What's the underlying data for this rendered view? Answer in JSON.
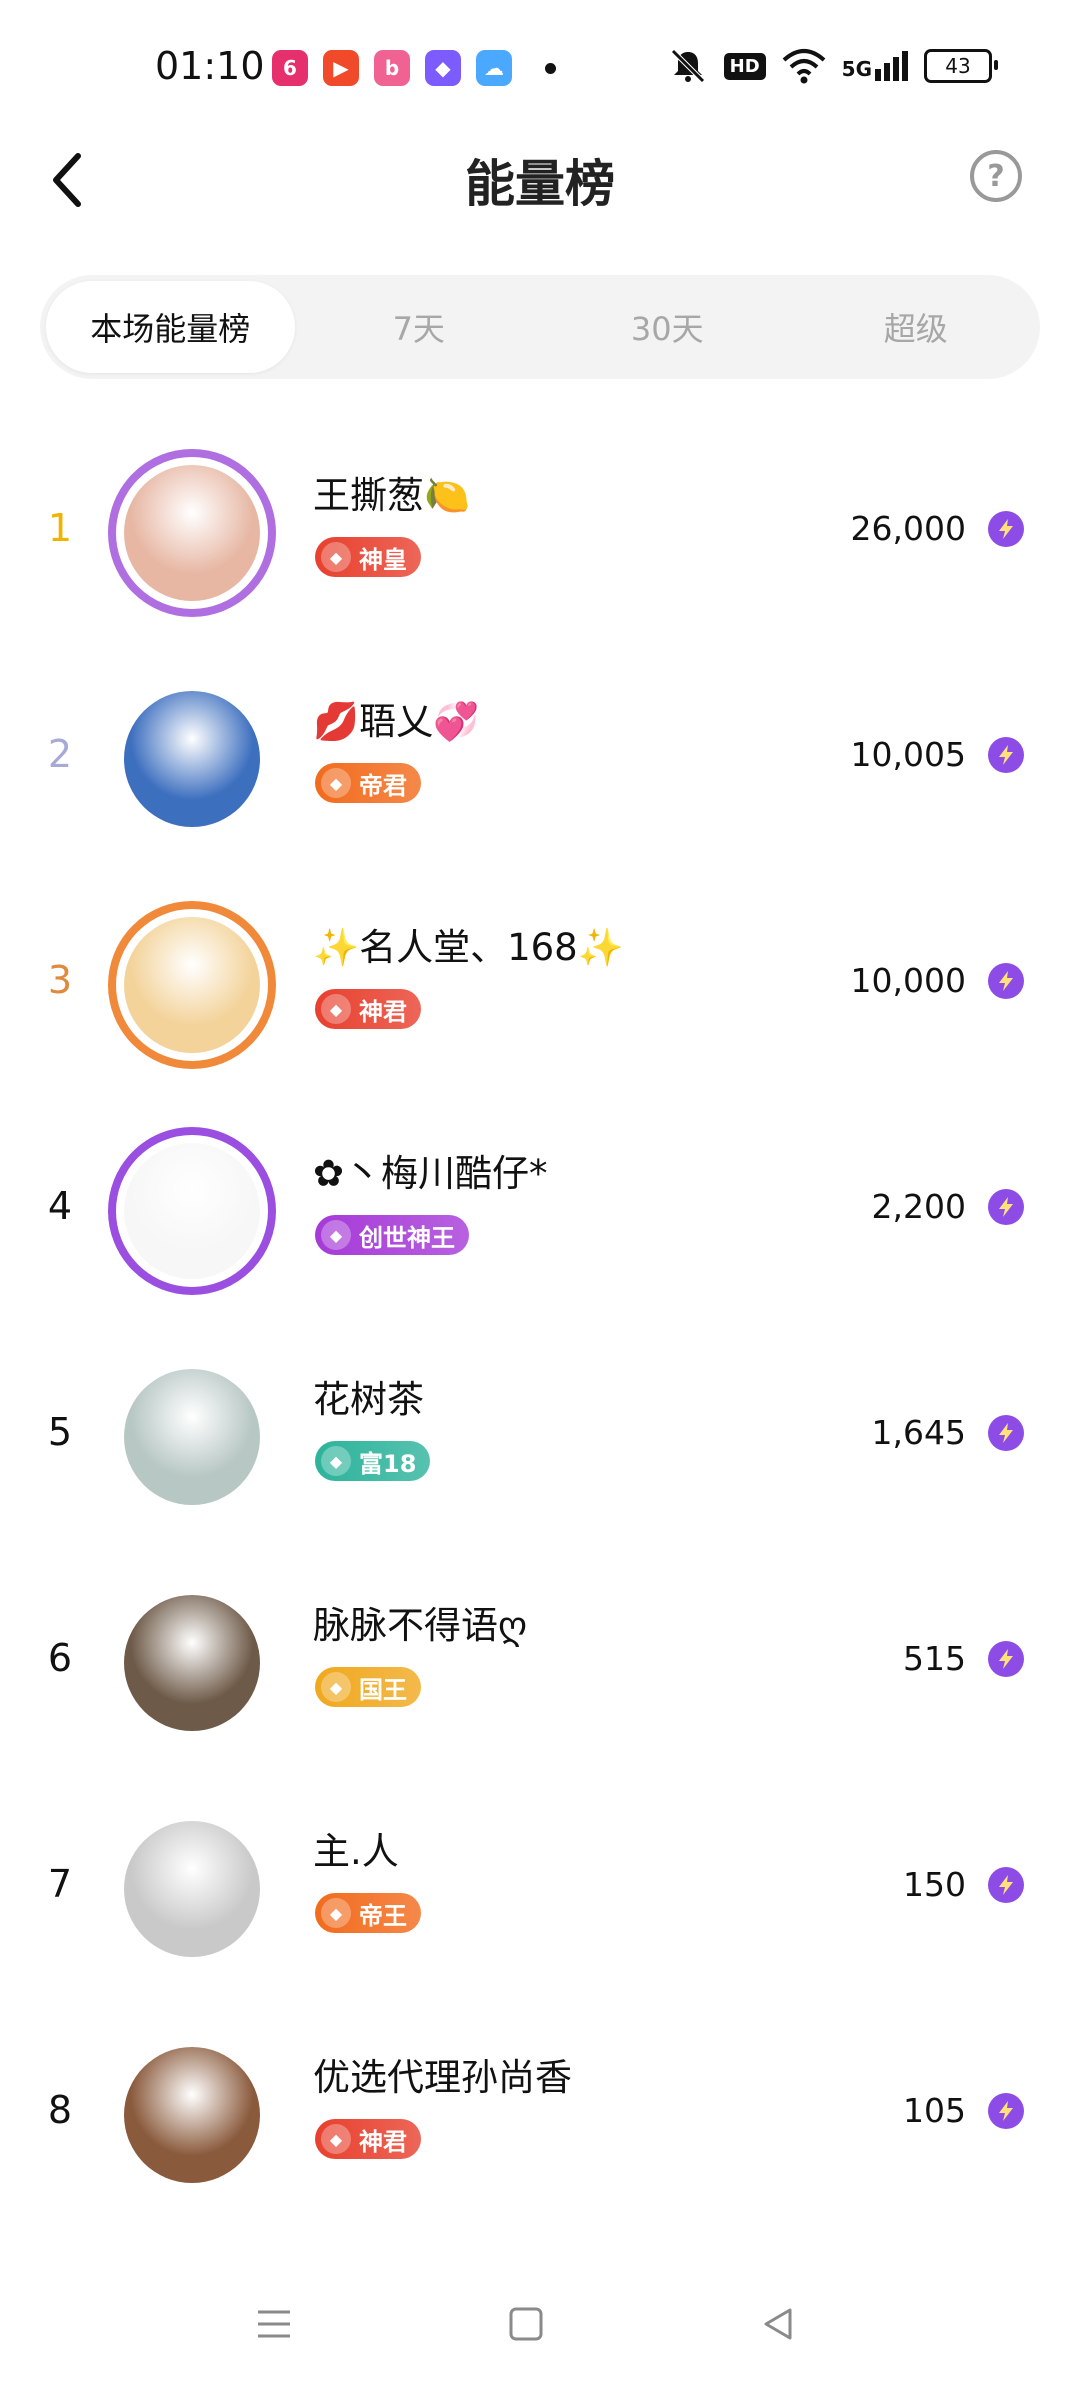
{
  "status_bar": {
    "time": "01:10",
    "apps": [
      {
        "name": "app-icon-1",
        "color": "#e6306e",
        "glyph": "6"
      },
      {
        "name": "app-icon-2",
        "color": "#f04a2a",
        "glyph": "▶"
      },
      {
        "name": "bilibili-icon",
        "color": "#f06292",
        "glyph": "b"
      },
      {
        "name": "app-icon-4",
        "color": "#7c5cff",
        "glyph": "◆"
      },
      {
        "name": "weather-icon",
        "color": "#4aa8ff",
        "glyph": "☁"
      }
    ],
    "hd": "HD",
    "network": "5G",
    "battery": "43"
  },
  "header": {
    "title": "能量榜"
  },
  "tabs": [
    {
      "label": "本场能量榜",
      "active": true
    },
    {
      "label": "7天",
      "active": false
    },
    {
      "label": "30天",
      "active": false
    },
    {
      "label": "超级",
      "active": false
    }
  ],
  "ranking": [
    {
      "rank": "1",
      "rank_color": "#f0b400",
      "name": "王撕葱🍋",
      "badge": "神皇",
      "badge_color": "#e8402e",
      "score": "26,000",
      "avatar_color": "#e7b7a4",
      "frame_color": "#b06fe0"
    },
    {
      "rank": "2",
      "rank_color": "#a9a9d6",
      "name": "💋䎸乂💞",
      "badge": "帝君",
      "badge_color": "#f26b1d",
      "score": "10,005",
      "avatar_color": "#3d6fbf",
      "frame_color": ""
    },
    {
      "rank": "3",
      "rank_color": "#e08a3c",
      "name": "✨名人堂、168✨",
      "badge": "神君",
      "badge_color": "#e8402e",
      "score": "10,000",
      "avatar_color": "#f3d39a",
      "frame_color": "#f08a3a"
    },
    {
      "rank": "4",
      "rank_color": "#111111",
      "name": "✿丶梅川酷仔*",
      "badge": "创世神王",
      "badge_color": "#a63ad8",
      "score": "2,200",
      "avatar_color": "#f7f7f7",
      "frame_color": "#9a4fe0"
    },
    {
      "rank": "5",
      "rank_color": "#111111",
      "name": "花树茶",
      "badge": "富18",
      "badge_color": "#2db39b",
      "score": "1,645",
      "avatar_color": "#b7c7c4",
      "frame_color": ""
    },
    {
      "rank": "6",
      "rank_color": "#111111",
      "name": "脉脉不得语ღ",
      "badge": "国王",
      "badge_color": "#f0a81e",
      "score": "515",
      "avatar_color": "#6e5a48",
      "frame_color": ""
    },
    {
      "rank": "7",
      "rank_color": "#111111",
      "name": "主.人",
      "badge": "帝王",
      "badge_color": "#f26b1d",
      "score": "150",
      "avatar_color": "#c9c9c9",
      "frame_color": ""
    },
    {
      "rank": "8",
      "rank_color": "#111111",
      "name": "优选代理孙尚香",
      "badge": "神君",
      "badge_color": "#e8402e",
      "score": "105",
      "avatar_color": "#8a5a3c",
      "frame_color": ""
    }
  ],
  "nav": {
    "menu_icon": "menu-icon",
    "home_icon": "home-icon",
    "back_icon": "back-triangle-icon"
  }
}
